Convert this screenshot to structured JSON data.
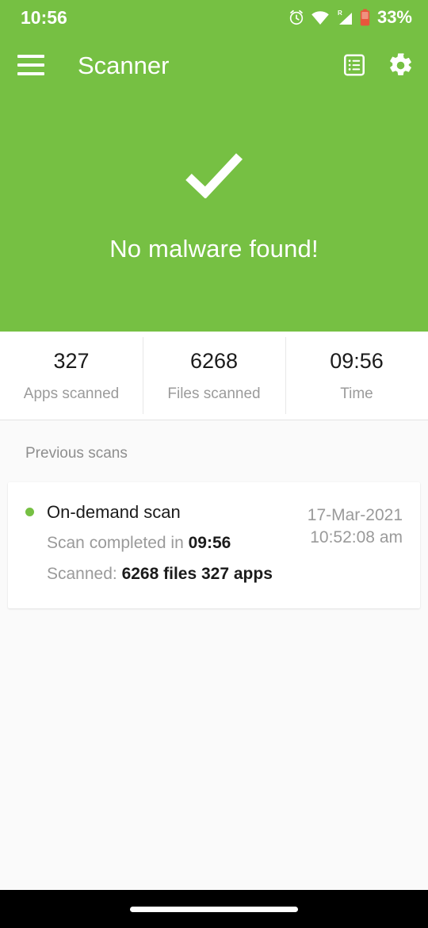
{
  "status_bar": {
    "clock": "10:56",
    "battery_percent": "33%",
    "icons": [
      "alarm-icon",
      "wifi-icon",
      "signal-roaming-icon",
      "battery-low-icon"
    ],
    "roaming_indicator": "R"
  },
  "app_bar": {
    "menu_icon": "hamburger-menu-icon",
    "title": "Scanner",
    "actions": [
      {
        "icon": "scan-log-icon",
        "label": "Scan log"
      },
      {
        "icon": "gear-icon",
        "label": "Settings"
      }
    ]
  },
  "hero": {
    "icon": "checkmark-icon",
    "message": "No malware found!",
    "background_color": "#76c043"
  },
  "stats": [
    {
      "value": "327",
      "label": "Apps scanned"
    },
    {
      "value": "6268",
      "label": "Files scanned"
    },
    {
      "value": "09:56",
      "label": "Time"
    }
  ],
  "previous_scans": {
    "section_title": "Previous scans",
    "items": [
      {
        "status_color": "#76c043",
        "title": "On-demand scan",
        "completed_prefix": "Scan completed in ",
        "completed_value": "09:56",
        "scanned_prefix": "Scanned: ",
        "scanned_value": "6268 files 327 apps",
        "date": "17-Mar-2021",
        "time": "10:52:08 am"
      }
    ]
  },
  "nav_bar": {
    "gesture_pill": "home-gesture-pill"
  }
}
